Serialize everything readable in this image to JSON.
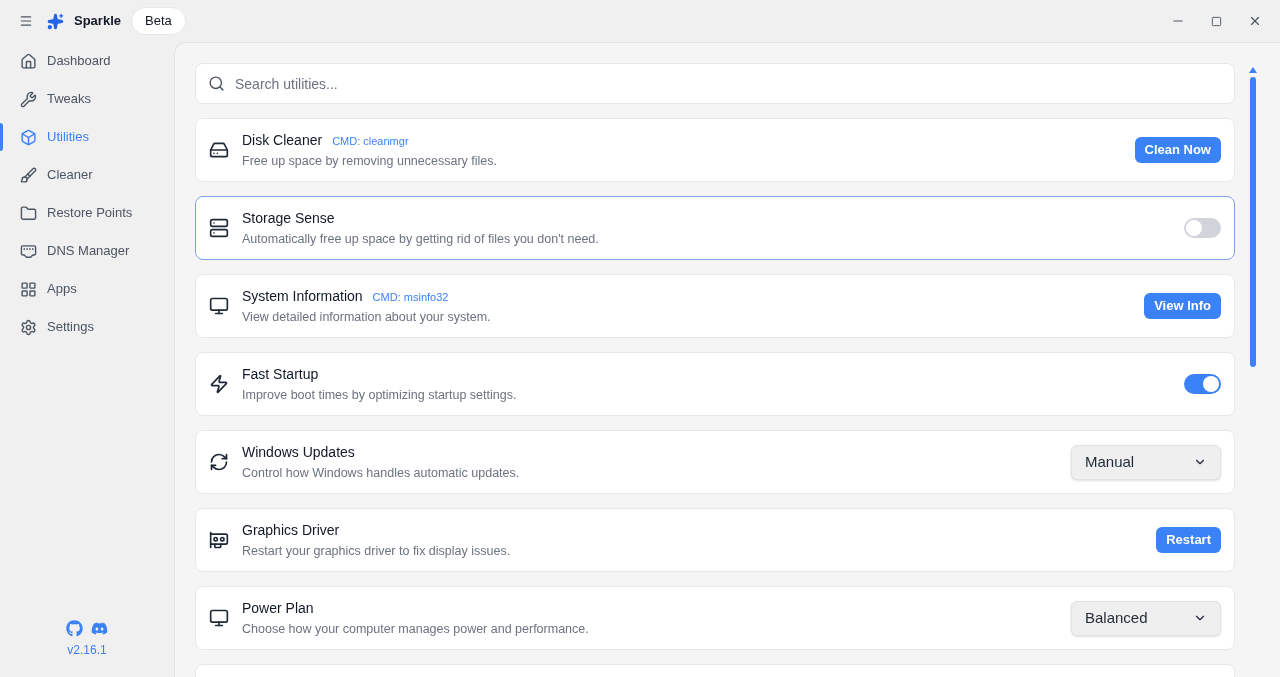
{
  "app": {
    "name": "Sparkle",
    "badge": "Beta"
  },
  "sidebar": {
    "items": [
      {
        "label": "Dashboard",
        "selected": false
      },
      {
        "label": "Tweaks",
        "selected": false
      },
      {
        "label": "Utilities",
        "selected": true
      },
      {
        "label": "Cleaner",
        "selected": false
      },
      {
        "label": "Restore Points",
        "selected": false
      },
      {
        "label": "DNS Manager",
        "selected": false
      },
      {
        "label": "Apps",
        "selected": false
      },
      {
        "label": "Settings",
        "selected": false
      }
    ],
    "version": "v2.16.1"
  },
  "search": {
    "placeholder": "Search utilities..."
  },
  "utilities": [
    {
      "title": "Disk Cleaner",
      "cmd": "CMD: cleanmgr",
      "description": "Free up space by removing unnecessary files.",
      "kind": "button",
      "action": "Clean Now",
      "highlighted": false
    },
    {
      "title": "Storage Sense",
      "description": "Automatically free up space by getting rid of files you don't need.",
      "kind": "toggle",
      "on": false,
      "highlighted": true
    },
    {
      "title": "System Information",
      "cmd": "CMD: msinfo32",
      "description": "View detailed information about your system.",
      "kind": "button",
      "action": "View Info",
      "highlighted": false
    },
    {
      "title": "Fast Startup",
      "description": "Improve boot times by optimizing startup settings.",
      "kind": "toggle",
      "on": true,
      "highlighted": false
    },
    {
      "title": "Windows Updates",
      "description": "Control how Windows handles automatic updates.",
      "kind": "select",
      "value": "Manual",
      "highlighted": false
    },
    {
      "title": "Graphics Driver",
      "description": "Restart your graphics driver to fix display issues.",
      "kind": "button",
      "action": "Restart",
      "highlighted": false
    },
    {
      "title": "Power Plan",
      "description": "Choose how your computer manages power and performance.",
      "kind": "select",
      "value": "Balanced",
      "highlighted": false
    },
    {
      "kind": "empty"
    }
  ]
}
